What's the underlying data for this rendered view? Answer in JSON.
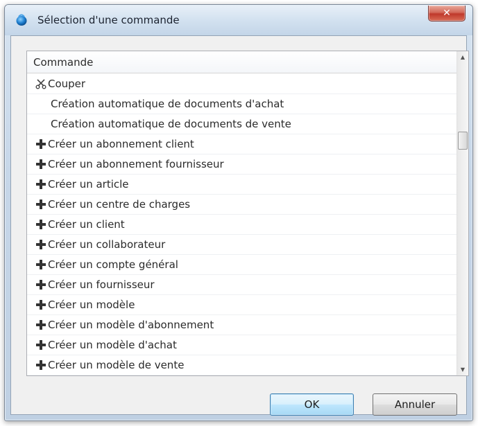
{
  "window": {
    "title": "Sélection d'une commande",
    "close_label": "✕"
  },
  "list": {
    "header": "Commande",
    "items": [
      {
        "icon": "scissors-icon",
        "label": "Couper"
      },
      {
        "icon": "none",
        "label": "Création automatique de documents d'achat"
      },
      {
        "icon": "none",
        "label": "Création automatique de documents de vente"
      },
      {
        "icon": "plus-icon",
        "label": "Créer un abonnement client"
      },
      {
        "icon": "plus-icon",
        "label": "Créer un abonnement fournisseur"
      },
      {
        "icon": "plus-icon",
        "label": "Créer un article"
      },
      {
        "icon": "plus-icon",
        "label": "Créer un centre de charges"
      },
      {
        "icon": "plus-icon",
        "label": "Créer un client"
      },
      {
        "icon": "plus-icon",
        "label": "Créer un collaborateur"
      },
      {
        "icon": "plus-icon",
        "label": "Créer un compte général"
      },
      {
        "icon": "plus-icon",
        "label": "Créer un fournisseur"
      },
      {
        "icon": "plus-icon",
        "label": "Créer un modèle"
      },
      {
        "icon": "plus-icon",
        "label": "Créer un modèle d'abonnement"
      },
      {
        "icon": "plus-icon",
        "label": "Créer un modèle d'achat"
      },
      {
        "icon": "plus-icon",
        "label": "Créer un modèle de vente"
      }
    ]
  },
  "buttons": {
    "ok": "OK",
    "cancel": "Annuler"
  }
}
